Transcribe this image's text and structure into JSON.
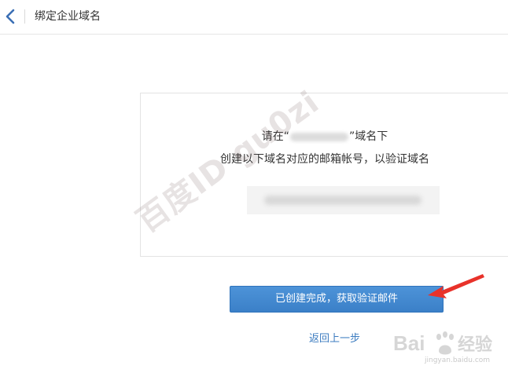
{
  "header": {
    "title": "绑定企业域名",
    "back_icon": "chevron-left-icon"
  },
  "card": {
    "line1_prefix": "请在“",
    "line1_suffix": "”域名下",
    "line2": "创建以下域名对应的邮箱帐号，以验证域名"
  },
  "actions": {
    "confirm_label": "已创建完成，获取验证邮件",
    "back_label": "返回上一步"
  },
  "overlay": {
    "watermark": "百度ID gu0zi",
    "brand_logo": "Bai 经验",
    "brand_url": "jingyan.baidu.com"
  },
  "colors": {
    "accent": "#3b80c8",
    "link": "#3c7cc0",
    "arrow": "#e8322a"
  }
}
